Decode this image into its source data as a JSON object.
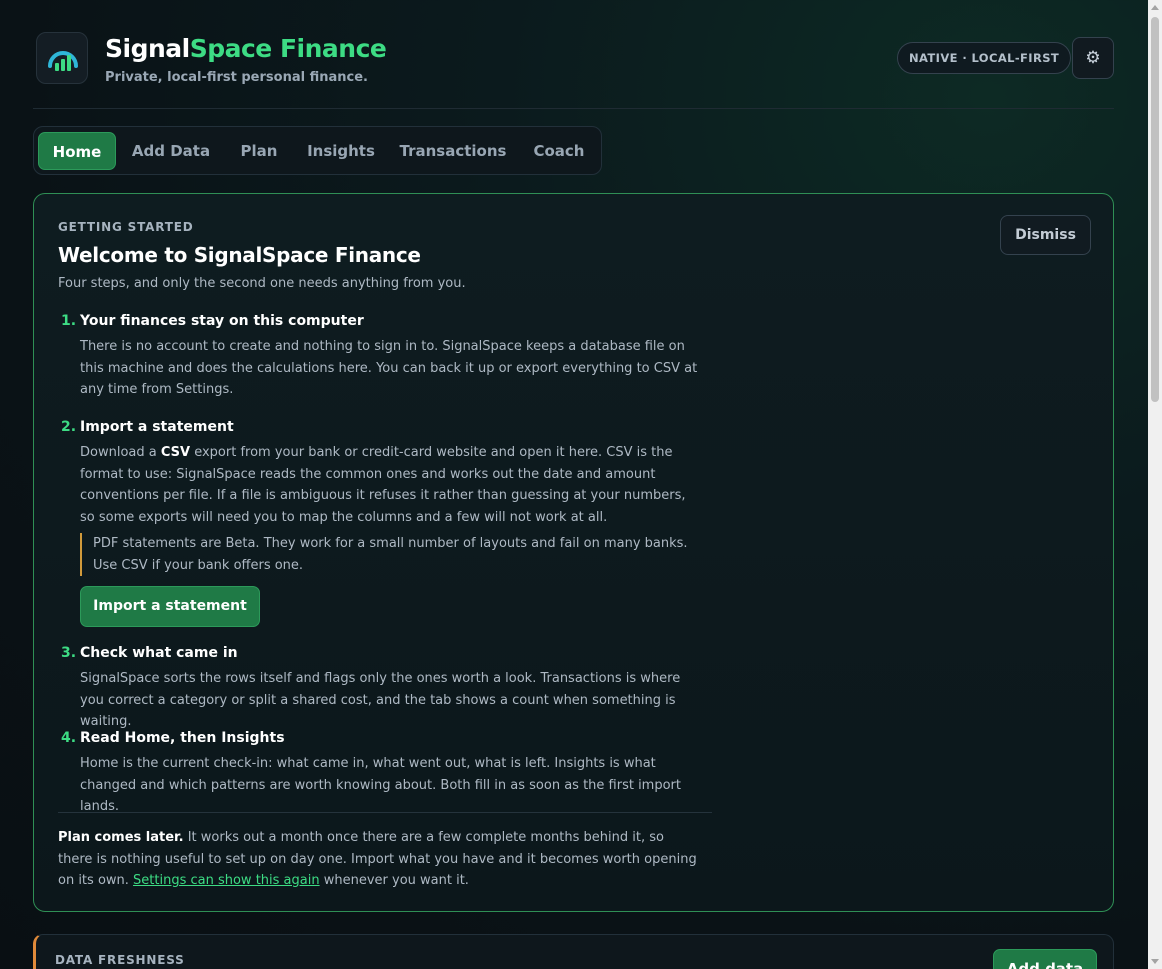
{
  "header": {
    "brand_part1": "Signal",
    "brand_part2": "Space Finance",
    "tagline": "Private, local-first personal finance.",
    "badge": "NATIVE · LOCAL-FIRST",
    "settings_icon": "gear-icon",
    "settings_glyph": "⚙"
  },
  "tabs": [
    {
      "label": "Home",
      "active": true
    },
    {
      "label": "Add Data",
      "active": false
    },
    {
      "label": "Plan",
      "active": false
    },
    {
      "label": "Insights",
      "active": false
    },
    {
      "label": "Transactions",
      "active": false
    },
    {
      "label": "Coach",
      "active": false
    }
  ],
  "getting_started": {
    "eyebrow": "GETTING STARTED",
    "title": "Welcome to SignalSpace Finance",
    "subtitle": "Four steps, and only the second one needs anything from you.",
    "dismiss_label": "Dismiss",
    "steps": [
      {
        "num": "1.",
        "title": "Your finances stay on this computer",
        "body": "There is no account to create and nothing to sign in to. SignalSpace keeps a database file on this machine and does the calculations here. You can back it up or export everything to CSV at any time from Settings."
      },
      {
        "num": "2.",
        "title": "Import a statement",
        "body_pre": "Download a ",
        "body_bold": "CSV",
        "body_post": " export from your bank or credit-card website and open it here. CSV is the format to use: SignalSpace reads the common ones and works out the date and amount conventions per file. If a file is ambiguous it refuses it rather than guessing at your numbers, so some exports will need you to map the columns and a few will not work at all.",
        "note": "PDF statements are Beta. They work for a small number of layouts and fail on many banks. Use CSV if your bank offers one.",
        "button_label": "Import a statement"
      },
      {
        "num": "3.",
        "title": "Check what came in",
        "body": "SignalSpace sorts the rows itself and flags only the ones worth a look. Transactions is where you correct a category or split a shared cost, and the tab shows a count when something is waiting."
      },
      {
        "num": "4.",
        "title": "Read Home, then Insights",
        "body": "Home is the current check-in: what came in, what went out, what is left. Insights is what changed and which patterns are worth knowing about. Both fill in as soon as the first import lands."
      }
    ],
    "footer_bold": "Plan comes later.",
    "footer_text": " It works out a month once there are a few complete months behind it, so there is nothing useful to set up on day one. Import what you have and it becomes worth opening on its own. ",
    "footer_link": "Settings can show this again",
    "footer_tail": " whenever you want it."
  },
  "data_freshness": {
    "eyebrow": "DATA FRESHNESS",
    "button_label": "Add data"
  },
  "colors": {
    "accent": "#3ddc84",
    "primary_button": "#1f7a46",
    "warning": "#d19a3b"
  }
}
